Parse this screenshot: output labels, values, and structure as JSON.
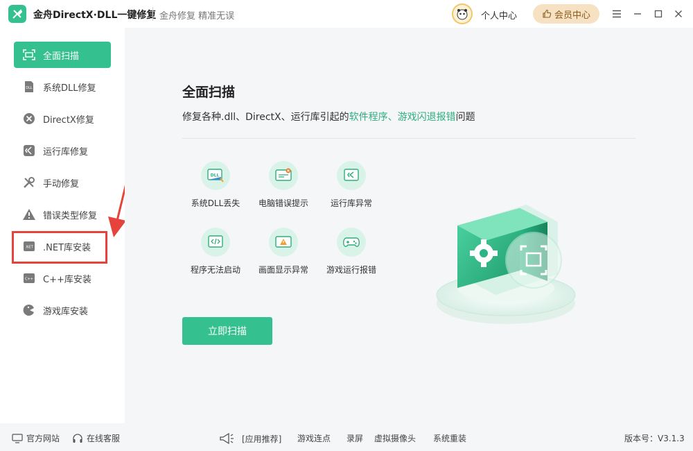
{
  "titlebar": {
    "app_title": "金舟DirectX·DLL一键修复",
    "subtitle": "金舟修复 精准无误",
    "personal_center": "个人中心",
    "member_center": "会员中心"
  },
  "sidebar": {
    "items": [
      {
        "label": "全面扫描",
        "icon": "scan-icon",
        "active": true
      },
      {
        "label": "系统DLL修复",
        "icon": "dll-icon"
      },
      {
        "label": "DirectX修复",
        "icon": "directx-icon"
      },
      {
        "label": "运行库修复",
        "icon": "runtime-icon"
      },
      {
        "label": "手动修复",
        "icon": "wrench-icon"
      },
      {
        "label": "错误类型修复",
        "icon": "warning-icon"
      },
      {
        "label": ".NET库安装",
        "icon": "dotnet-icon",
        "highlighted": true
      },
      {
        "label": "C++库安装",
        "icon": "cpp-icon"
      },
      {
        "label": "游戏库安装",
        "icon": "game-icon"
      }
    ]
  },
  "main": {
    "title": "全面扫描",
    "desc_prefix": "修复各种.dll、DirectX、运行库引起的",
    "desc_highlight": "软件程序、游戏闪退报错",
    "desc_suffix": "问题",
    "features": [
      {
        "label": "系统DLL丢失",
        "icon": "dll-missing-icon"
      },
      {
        "label": "电脑错误提示",
        "icon": "error-prompt-icon"
      },
      {
        "label": "运行库异常",
        "icon": "runtime-error-icon"
      },
      {
        "label": "程序无法启动",
        "icon": "program-fail-icon"
      },
      {
        "label": "画面显示异常",
        "icon": "display-error-icon"
      },
      {
        "label": "游戏运行报错",
        "icon": "gamepad-icon"
      }
    ],
    "scan_button": "立即扫描"
  },
  "footer": {
    "official_site": "官方网站",
    "online_service": "在线客服",
    "recommend": "[应用推荐]",
    "links": [
      "游戏连点",
      "录屏",
      "虚拟摄像头",
      "系统重装"
    ],
    "version": "版本号：V3.1.3"
  },
  "colors": {
    "accent": "#34c08f",
    "highlight_text": "#2fae7f",
    "annotation_red": "#e5433b",
    "member_bg": "#f6e2c3"
  }
}
